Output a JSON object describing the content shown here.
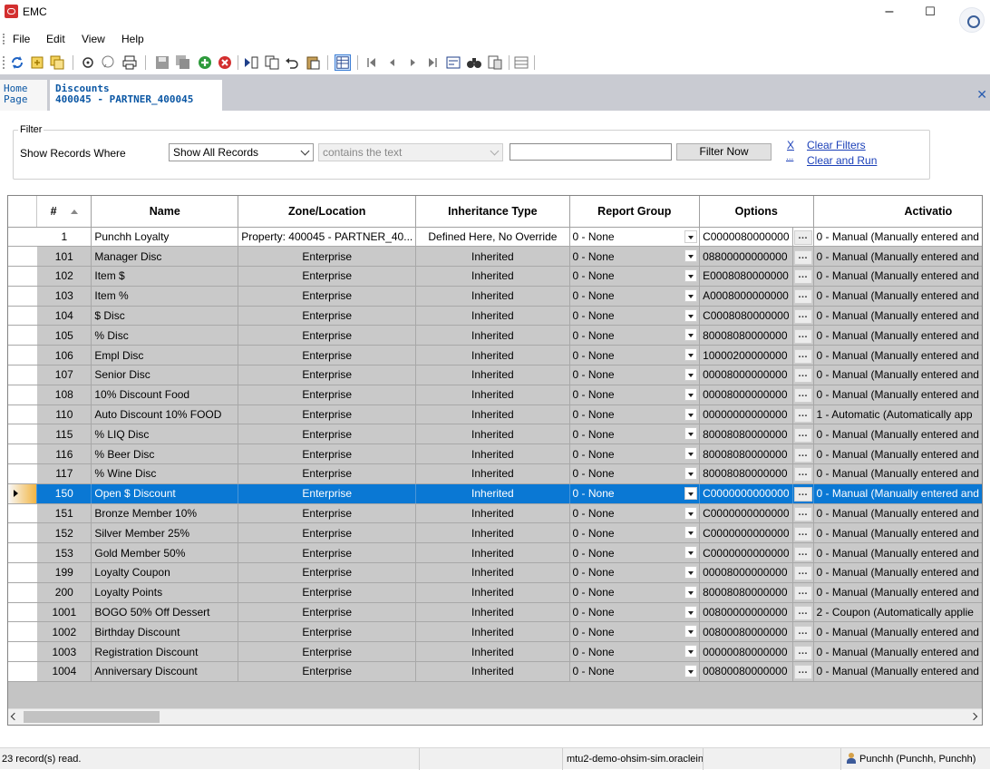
{
  "window": {
    "title": "EMC"
  },
  "menu": [
    "File",
    "Edit",
    "View",
    "Help"
  ],
  "tabs": {
    "home": {
      "line1": "Home",
      "line2": "Page"
    },
    "active": {
      "line1": "Discounts",
      "line2": "400045 - PARTNER_400045"
    }
  },
  "filter": {
    "legend": "Filter",
    "label": "Show Records Where",
    "field_select": "Show All Records",
    "operator_select": "contains the text",
    "value_input": "",
    "filter_now": "Filter Now",
    "clear_x": "X",
    "clear_ellipsis": "...",
    "clear_filters": "Clear Filters",
    "clear_and_run": "Clear and Run"
  },
  "grid": {
    "columns": [
      "#",
      "Name",
      "Zone/Location",
      "Inheritance Type",
      "Report Group",
      "Options",
      "Activatio"
    ],
    "ellipsis": "…",
    "rows": [
      {
        "num": "1",
        "name": "Punchh Loyalty",
        "zone": "Property: 400045 - PARTNER_40...",
        "inherit": "Defined Here, No Override",
        "group": "0 - None",
        "options": "C0000080000000",
        "activation": "0 - Manual (Manually entered and"
      },
      {
        "num": "101",
        "name": "Manager Disc",
        "zone": "Enterprise",
        "inherit": "Inherited",
        "group": "0 - None",
        "options": "08800000000000",
        "activation": "0 - Manual (Manually entered and"
      },
      {
        "num": "102",
        "name": "Item $",
        "zone": "Enterprise",
        "inherit": "Inherited",
        "group": "0 - None",
        "options": "E0008080000000",
        "activation": "0 - Manual (Manually entered and"
      },
      {
        "num": "103",
        "name": "Item %",
        "zone": "Enterprise",
        "inherit": "Inherited",
        "group": "0 - None",
        "options": "A0008000000000",
        "activation": "0 - Manual (Manually entered and"
      },
      {
        "num": "104",
        "name": "$ Disc",
        "zone": "Enterprise",
        "inherit": "Inherited",
        "group": "0 - None",
        "options": "C0008080000000",
        "activation": "0 - Manual (Manually entered and"
      },
      {
        "num": "105",
        "name": "% Disc",
        "zone": "Enterprise",
        "inherit": "Inherited",
        "group": "0 - None",
        "options": "80008080000000",
        "activation": "0 - Manual (Manually entered and"
      },
      {
        "num": "106",
        "name": "Empl Disc",
        "zone": "Enterprise",
        "inherit": "Inherited",
        "group": "0 - None",
        "options": "10000200000000",
        "activation": "0 - Manual (Manually entered and"
      },
      {
        "num": "107",
        "name": "Senior Disc",
        "zone": "Enterprise",
        "inherit": "Inherited",
        "group": "0 - None",
        "options": "00008000000000",
        "activation": "0 - Manual (Manually entered and"
      },
      {
        "num": "108",
        "name": "10% Discount Food",
        "zone": "Enterprise",
        "inherit": "Inherited",
        "group": "0 - None",
        "options": "00008000000000",
        "activation": "0 - Manual (Manually entered and"
      },
      {
        "num": "110",
        "name": "Auto Discount 10% FOOD",
        "zone": "Enterprise",
        "inherit": "Inherited",
        "group": "0 - None",
        "options": "00000000000000",
        "activation": "1 - Automatic (Automatically app"
      },
      {
        "num": "115",
        "name": "% LIQ Disc",
        "zone": "Enterprise",
        "inherit": "Inherited",
        "group": "0 - None",
        "options": "80008080000000",
        "activation": "0 - Manual (Manually entered and"
      },
      {
        "num": "116",
        "name": "% Beer Disc",
        "zone": "Enterprise",
        "inherit": "Inherited",
        "group": "0 - None",
        "options": "80008080000000",
        "activation": "0 - Manual (Manually entered and"
      },
      {
        "num": "117",
        "name": "% Wine Disc",
        "zone": "Enterprise",
        "inherit": "Inherited",
        "group": "0 - None",
        "options": "80008080000000",
        "activation": "0 - Manual (Manually entered and"
      },
      {
        "num": "150",
        "name": "Open $ Discount",
        "zone": "Enterprise",
        "inherit": "Inherited",
        "group": "0 - None",
        "options": "C0000000000000",
        "activation": "0 - Manual (Manually entered and"
      },
      {
        "num": "151",
        "name": "Bronze Member 10%",
        "zone": "Enterprise",
        "inherit": "Inherited",
        "group": "0 - None",
        "options": "C0000000000000",
        "activation": "0 - Manual (Manually entered and"
      },
      {
        "num": "152",
        "name": "Silver Member 25%",
        "zone": "Enterprise",
        "inherit": "Inherited",
        "group": "0 - None",
        "options": "C0000000000000",
        "activation": "0 - Manual (Manually entered and"
      },
      {
        "num": "153",
        "name": "Gold Member 50%",
        "zone": "Enterprise",
        "inherit": "Inherited",
        "group": "0 - None",
        "options": "C0000000000000",
        "activation": "0 - Manual (Manually entered and"
      },
      {
        "num": "199",
        "name": "Loyalty Coupon",
        "zone": "Enterprise",
        "inherit": "Inherited",
        "group": "0 - None",
        "options": "00008000000000",
        "activation": "0 - Manual (Manually entered and"
      },
      {
        "num": "200",
        "name": "Loyalty Points",
        "zone": "Enterprise",
        "inherit": "Inherited",
        "group": "0 - None",
        "options": "80008080000000",
        "activation": "0 - Manual (Manually entered and"
      },
      {
        "num": "1001",
        "name": "BOGO 50% Off Dessert",
        "zone": "Enterprise",
        "inherit": "Inherited",
        "group": "0 - None",
        "options": "00800000000000",
        "activation": "2 - Coupon (Automatically applie"
      },
      {
        "num": "1002",
        "name": "Birthday Discount",
        "zone": "Enterprise",
        "inherit": "Inherited",
        "group": "0 - None",
        "options": "00800080000000",
        "activation": "0 - Manual (Manually entered and"
      },
      {
        "num": "1003",
        "name": "Registration Discount",
        "zone": "Enterprise",
        "inherit": "Inherited",
        "group": "0 - None",
        "options": "00000080000000",
        "activation": "0 - Manual (Manually entered and"
      },
      {
        "num": "1004",
        "name": "Anniversary Discount",
        "zone": "Enterprise",
        "inherit": "Inherited",
        "group": "0 - None",
        "options": "00800080000000",
        "activation": "0 - Manual (Manually entered and"
      }
    ],
    "current_row_num": "150"
  },
  "status": {
    "records": "23 record(s) read.",
    "server": "mtu2-demo-ohsim-sim.oraclein-",
    "user": "Punchh (Punchh, Punchh)"
  },
  "colors": {
    "selection": "#0a78d4",
    "link": "#1a3fb8",
    "tab_text": "#0b57a4"
  }
}
